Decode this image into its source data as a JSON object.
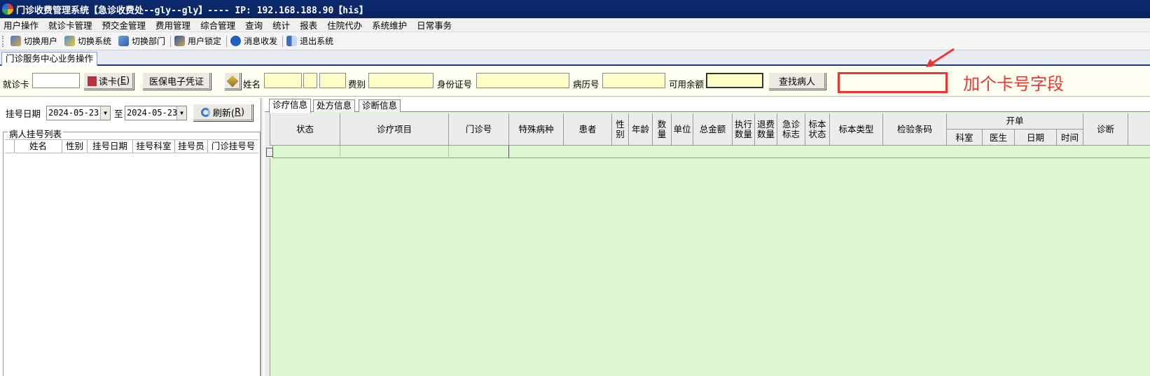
{
  "window": {
    "title": "门诊收费管理系统【急诊收费处--gly--gly】---- IP: 192.168.188.90【his】"
  },
  "menu": [
    "用户操作",
    "就诊卡管理",
    "预交金管理",
    "费用管理",
    "综合管理",
    "查询",
    "统计",
    "报表",
    "住院代办",
    "系统维护",
    "日常事务"
  ],
  "toolbar": {
    "switch_user": "切换用户",
    "switch_system": "切换系统",
    "switch_dept": "切换部门",
    "user_lock": "用户锁定",
    "messages": "消息收发",
    "exit": "退出系统"
  },
  "main_tab": "门诊服务中心业务操作",
  "search": {
    "card_label": "就诊卡",
    "read_card": "读卡(",
    "read_card_key": "E",
    "read_card_close": ")",
    "insurance_voucher": "医保电子凭证",
    "name_label": "姓名",
    "fee_type_label": "费别",
    "id_label": "身份证号",
    "record_label": "病历号",
    "balance_label": "可用余额",
    "find_patient": "查找病人"
  },
  "annotation": {
    "text": "加个卡号字段",
    "color": "#ef3434"
  },
  "left_panel": {
    "date_label": "挂号日期",
    "date_from": "2024-05-23",
    "to_label": "至",
    "date_to": "2024-05-23",
    "refresh": "刷新(",
    "refresh_key": "R",
    "refresh_close": ")",
    "list_title": "病人挂号列表",
    "columns": [
      "姓名",
      "性别",
      "挂号日期",
      "挂号科室",
      "挂号员",
      "门诊挂号号"
    ]
  },
  "right_panel": {
    "tabs": [
      "诊疗信息",
      "处方信息",
      "诊断信息"
    ],
    "columns": {
      "status": "状态",
      "item": "诊疗项目",
      "outpatient_no": "门诊号",
      "special_disease": "特殊病种",
      "patient": "患者",
      "sex_1": "性",
      "sex_2": "别",
      "age": "年龄",
      "qty_1": "数",
      "qty_2": "量",
      "unit": "单位",
      "total": "总金额",
      "exec_1": "执行",
      "exec_2": "数量",
      "refund_1": "退费",
      "refund_2": "数量",
      "emerg_1": "急诊",
      "emerg_2": "标志",
      "spec_1": "标本",
      "spec_2": "状态",
      "specimen_type": "标本类型",
      "barcode": "检验条码",
      "order_group": "开单",
      "dept": "科室",
      "doctor": "医生",
      "date": "日期",
      "time": "时间",
      "diagnosis": "诊断"
    }
  },
  "colors": {
    "title_bar": "#0a2463",
    "grid_background": "#ddf7d0",
    "input_yellow": "#ffffc6"
  }
}
